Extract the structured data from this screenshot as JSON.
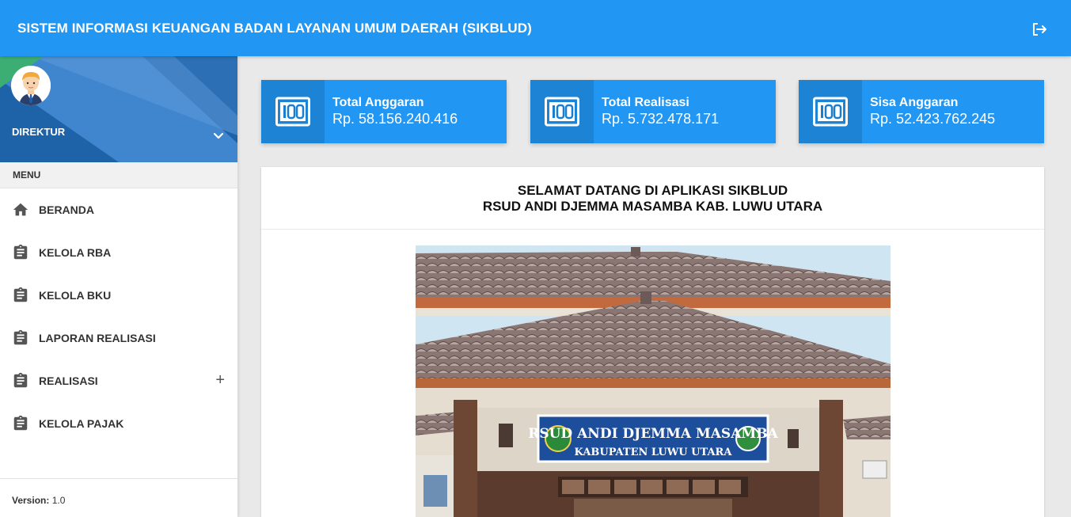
{
  "header": {
    "title": "SISTEM INFORMASI KEUANGAN BADAN LAYANAN UMUM DAERAH (SIKBLUD)",
    "logout_icon": "logout-icon"
  },
  "sidebar": {
    "user": {
      "name": "DIREKTUR"
    },
    "menu_header": "MENU",
    "items": [
      {
        "label": "BERANDA",
        "icon": "home-icon"
      },
      {
        "label": "KELOLA RBA",
        "icon": "assignment-icon"
      },
      {
        "label": "KELOLA BKU",
        "icon": "assignment-icon"
      },
      {
        "label": "LAPORAN REALISASI",
        "icon": "assignment-icon"
      },
      {
        "label": "REALISASI",
        "icon": "assignment-icon",
        "expand": "+"
      },
      {
        "label": "KELOLA PAJAK",
        "icon": "assignment-icon"
      }
    ],
    "footer": {
      "version_label": "Version:",
      "version_value": "1.0"
    }
  },
  "stats": [
    {
      "label": "Total Anggaran",
      "value": "Rp. 58.156.240.416",
      "icon": "money-icon"
    },
    {
      "label": "Total Realisasi",
      "value": "Rp. 5.732.478.171",
      "icon": "money-icon"
    },
    {
      "label": "Sisa Anggaran",
      "value": "Rp. 52.423.762.245",
      "icon": "money-icon"
    }
  ],
  "welcome": {
    "line1": "SELAMAT DATANG DI APLIKASI SIKBLUD",
    "line2": "RSUD ANDI DJEMMA MASAMBA KAB. LUWU UTARA",
    "sign_line1": "RSUD ANDI DJEMMA MASAMBA",
    "sign_line2": "KABUPATEN LUWU UTARA"
  },
  "colors": {
    "primary": "#2196f3",
    "sidebar_header": "#1e62a8"
  }
}
